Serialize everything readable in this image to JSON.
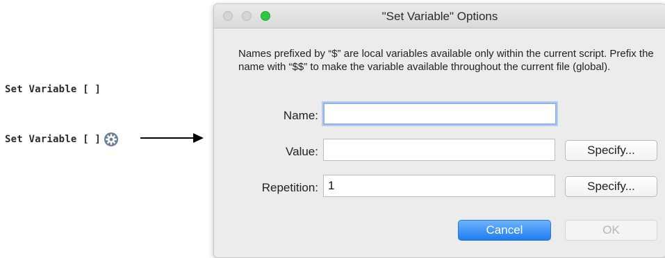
{
  "script_steps": [
    {
      "label": "Set Variable [ ]"
    },
    {
      "label": "Set Variable [ ]",
      "icon": "gear-icon"
    }
  ],
  "annotation": {
    "icon": "arrow-right-icon"
  },
  "dialog": {
    "title": "\"Set Variable\" Options",
    "description": "Names prefixed by “$” are local variables available only within the current script. Prefix the name with “$$” to make the variable available throughout the current file (global).",
    "fields": {
      "name": {
        "label": "Name:",
        "value": ""
      },
      "value": {
        "label": "Value:",
        "value": "",
        "button": "Specify..."
      },
      "repetition": {
        "label": "Repetition:",
        "value": "1",
        "button": "Specify..."
      }
    },
    "buttons": {
      "cancel": "Cancel",
      "ok": "OK"
    },
    "colors": {
      "close": "#d5d5d5",
      "minimize": "#d5d5d5",
      "zoom": "#2ec83e",
      "primary_button": "#1f7cf0",
      "focus_ring": "#8fb4ea"
    }
  }
}
